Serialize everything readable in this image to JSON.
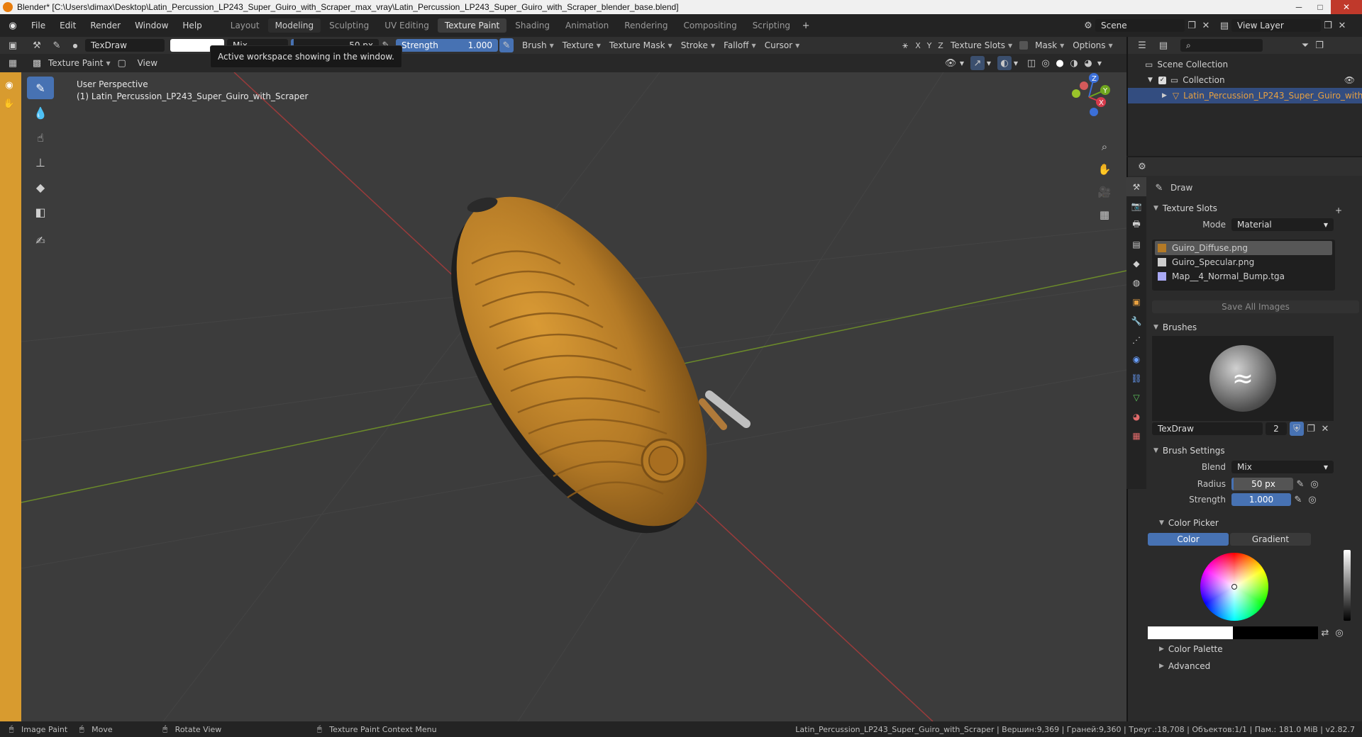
{
  "window": {
    "title": "Blender* [C:\\Users\\dimax\\Desktop\\Latin_Percussion_LP243_Super_Guiro_with_Scraper_max_vray\\Latin_Percussion_LP243_Super_Guiro_with_Scraper_blender_base.blend]"
  },
  "menu": [
    "File",
    "Edit",
    "Render",
    "Window",
    "Help"
  ],
  "workspaces": [
    "Layout",
    "Modeling",
    "Sculpting",
    "UV Editing",
    "Texture Paint",
    "Shading",
    "Animation",
    "Rendering",
    "Compositing",
    "Scripting"
  ],
  "active_workspace": "Texture Paint",
  "scene": {
    "label": "Scene",
    "view_layer": "View Layer"
  },
  "tool_header": {
    "brush_name": "TexDraw",
    "blend": "Mix",
    "radius": "50 px",
    "strength_label": "Strength",
    "strength_value": "1.000",
    "menus": [
      "Brush",
      "Texture",
      "Texture Mask",
      "Stroke",
      "Falloff",
      "Cursor"
    ],
    "axes": [
      "X",
      "Y",
      "Z"
    ],
    "right_menus": [
      "Texture Slots",
      "Mask",
      "Options"
    ]
  },
  "view_header": {
    "mode": "Texture Paint",
    "view": "View"
  },
  "tooltip": "Active workspace showing in the window.",
  "viewport": {
    "perspective": "User Perspective",
    "object": "(1) Latin_Percussion_LP243_Super_Guiro_with_Scraper",
    "gizmo_axes": [
      "Z",
      "Y",
      "X"
    ]
  },
  "outliner": {
    "root": "Scene Collection",
    "collection": "Collection",
    "object": "Latin_Percussion_LP243_Super_Guiro_with_"
  },
  "properties": {
    "active_tool": "Draw",
    "texture_slots": {
      "title": "Texture Slots",
      "mode_label": "Mode",
      "mode_value": "Material",
      "slots": [
        "Guiro_Diffuse.png",
        "Guiro_Specular.png",
        "Map__4_Normal_Bump.tga"
      ],
      "save_all": "Save All Images"
    },
    "brushes": {
      "title": "Brushes",
      "brush_name": "TexDraw",
      "users": "2"
    },
    "brush_settings": {
      "title": "Brush Settings",
      "blend_label": "Blend",
      "blend_value": "Mix",
      "radius_label": "Radius",
      "radius_value": "50 px",
      "strength_label": "Strength",
      "strength_value": "1.000"
    },
    "color_picker": {
      "title": "Color Picker",
      "tab_color": "Color",
      "tab_gradient": "Gradient"
    },
    "color_palette": "Color Palette",
    "advanced": "Advanced"
  },
  "statusbar": {
    "left": [
      "Image Paint",
      "Move",
      "Rotate View",
      "Texture Paint Context Menu"
    ],
    "stats": "Latin_Percussion_LP243_Super_Guiro_with_Scraper | Вершин:9,369 | Граней:9,360 | Треуг.:18,708 | Объектов:1/1 | Пам.: 181.0 MiB | v2.82.7"
  },
  "colors": {
    "accent": "#4772b3",
    "object": "#b47a26",
    "mode_strip": "#d89b2f"
  }
}
